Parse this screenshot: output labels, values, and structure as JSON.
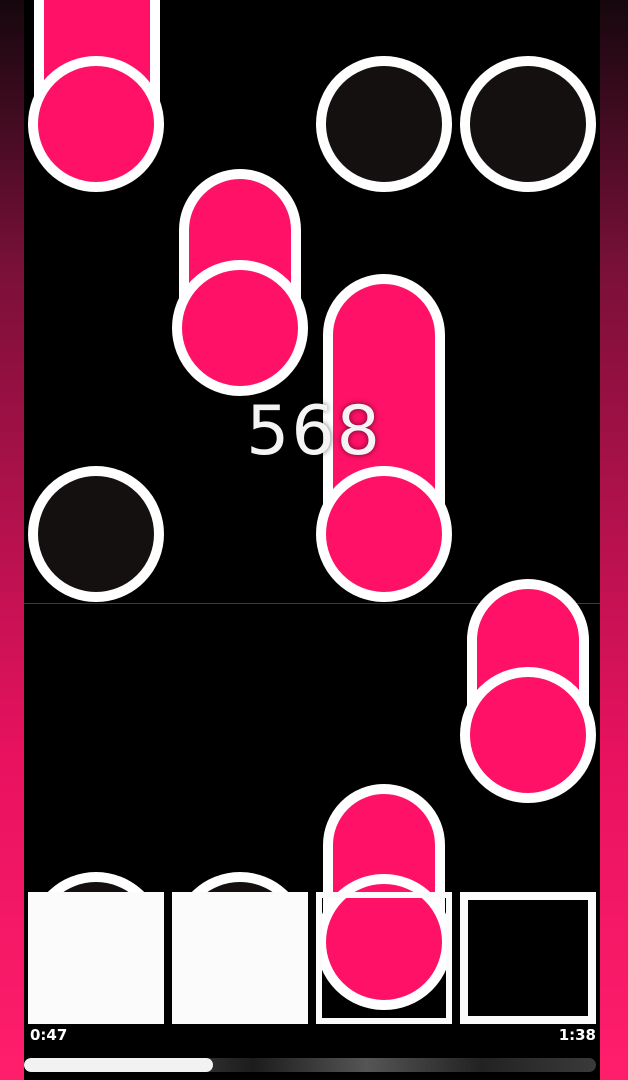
{
  "game": {
    "score": "568",
    "time_elapsed": "0:47",
    "time_total": "1:38",
    "progress_fraction": 0.33,
    "colors": {
      "note_fill": "#ff1167",
      "note_border": "#ffffff",
      "empty_note_fill": "#141010",
      "background": "#000000"
    },
    "lane_keys": [
      "lane-1",
      "lane-2",
      "lane-3",
      "lane-4"
    ],
    "lane_states": [
      "pressed",
      "pressed",
      "released",
      "released"
    ]
  }
}
